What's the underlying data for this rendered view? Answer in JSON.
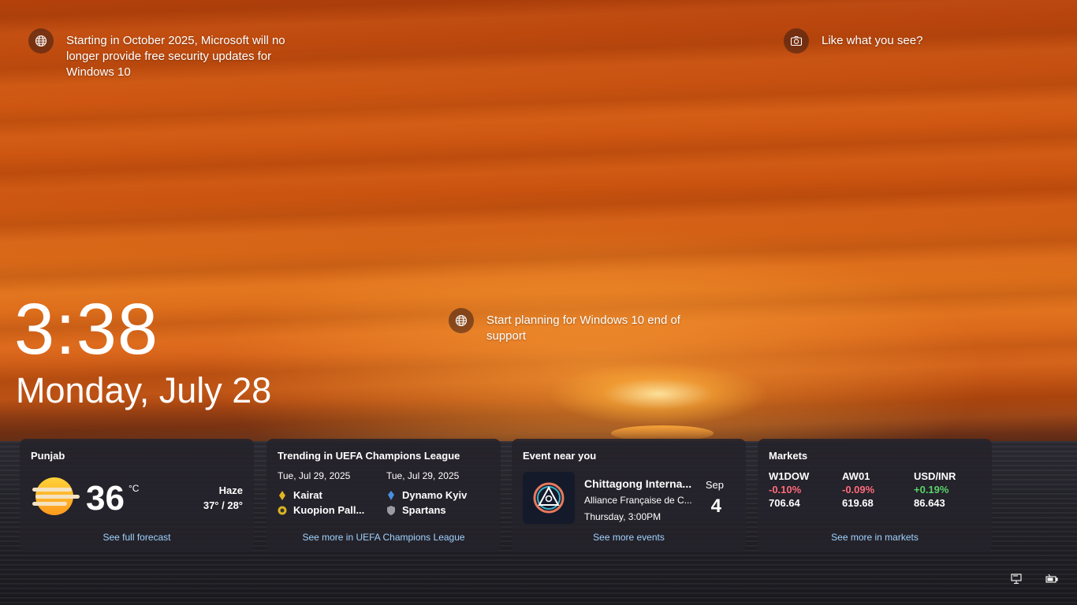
{
  "notices": {
    "security": "Starting in October 2025, Microsoft will no longer provide free security updates for Windows 10",
    "like": "Like what you see?",
    "planning": "Start planning for Windows 10 end of support"
  },
  "clock": {
    "time": "3:38",
    "date": "Monday, July 28"
  },
  "weather": {
    "location": "Punjab",
    "temp": "36",
    "unit": "°C",
    "condition": "Haze",
    "range": "37° / 28°",
    "link": "See full forecast"
  },
  "sports": {
    "title": "Trending in UEFA Champions League",
    "matches": [
      {
        "date": "Tue, Jul 29, 2025",
        "team1": "Kairat",
        "team2": "Kuopion Pall..."
      },
      {
        "date": "Tue, Jul 29, 2025",
        "team1": "Dynamo Kyiv",
        "team2": "Spartans"
      }
    ],
    "link": "See more in UEFA Champions League"
  },
  "event": {
    "title": "Event near you",
    "name": "Chittagong Interna...",
    "venue": "Alliance Française de C...",
    "time": "Thursday, 3:00PM",
    "month": "Sep",
    "day": "4",
    "link": "See more events"
  },
  "markets": {
    "title": "Markets",
    "items": [
      {
        "symbol": "W1DOW",
        "change": "-0.10%",
        "value": "706.64",
        "direction": "down"
      },
      {
        "symbol": "AW01",
        "change": "-0.09%",
        "value": "619.68",
        "direction": "down"
      },
      {
        "symbol": "USD/INR",
        "change": "+0.19%",
        "value": "86.643",
        "direction": "up"
      }
    ],
    "link": "See more in markets"
  },
  "colors": {
    "link": "#9fd3ff",
    "negative": "#ff6b7a",
    "positive": "#5ad36a"
  }
}
